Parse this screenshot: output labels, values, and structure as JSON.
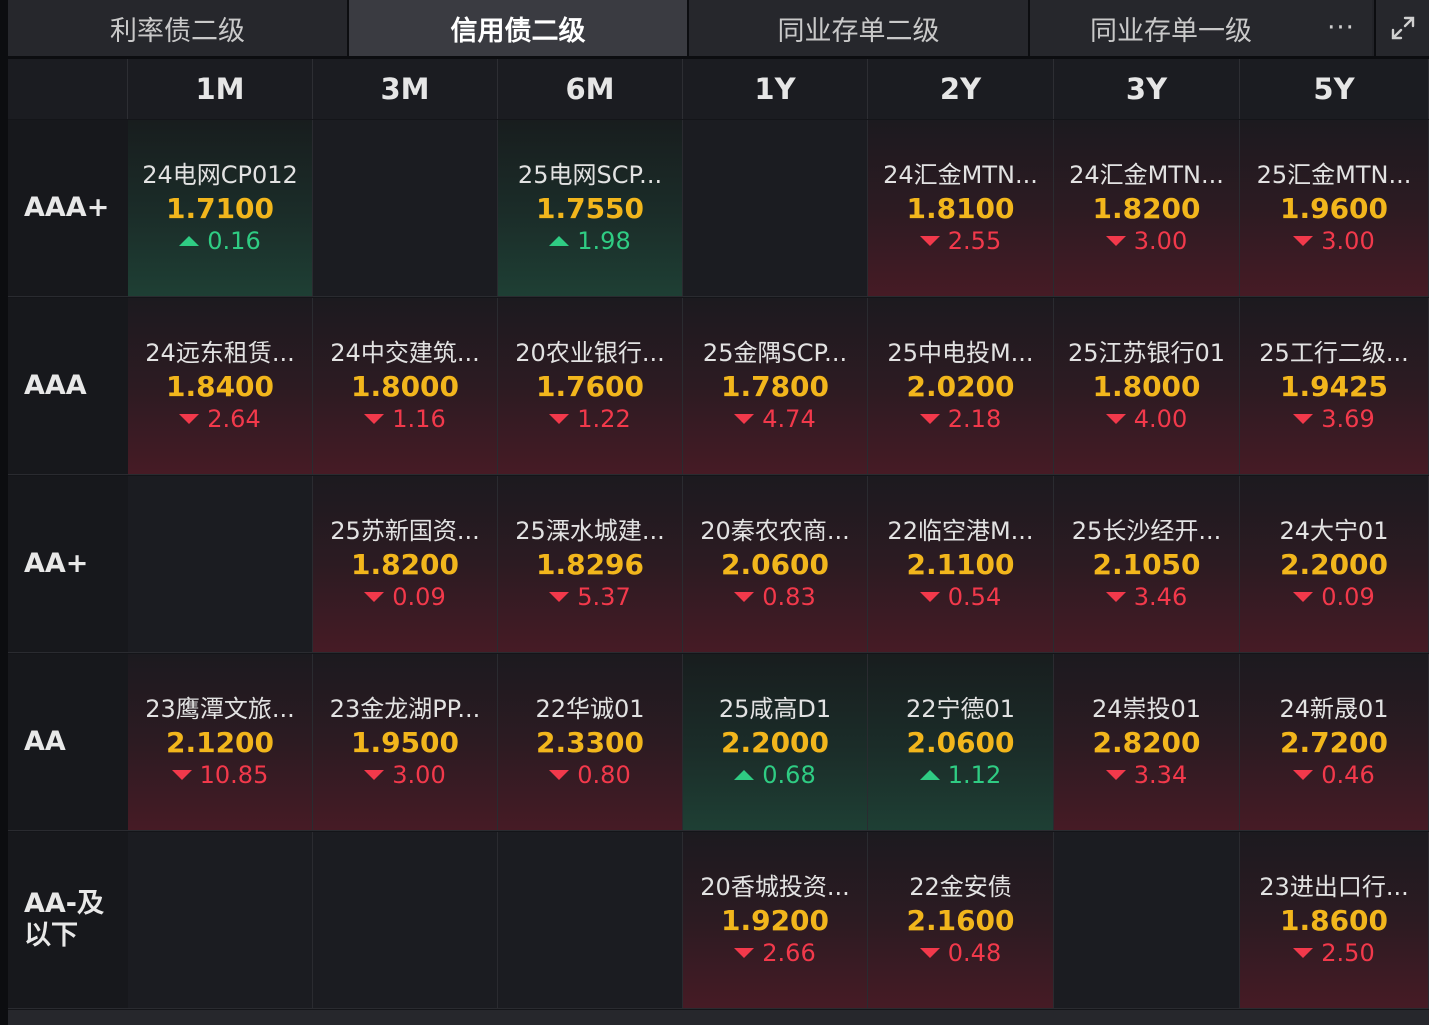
{
  "tabs": [
    {
      "label": "利率债二级",
      "active": false
    },
    {
      "label": "信用债二级",
      "active": true
    },
    {
      "label": "同业存单二级",
      "active": false
    },
    {
      "label": "同业存单一级",
      "active": false
    }
  ],
  "tab_more_label": "···",
  "columns": [
    "1M",
    "3M",
    "6M",
    "1Y",
    "2Y",
    "3Y",
    "5Y"
  ],
  "rows": [
    {
      "rating": "AAA+",
      "cells": [
        {
          "name": "24电网CP012",
          "yield": "1.7100",
          "change": "0.16",
          "dir": "up"
        },
        null,
        {
          "name": "25电网SCP...",
          "yield": "1.7550",
          "change": "1.98",
          "dir": "up"
        },
        null,
        {
          "name": "24汇金MTN...",
          "yield": "1.8100",
          "change": "2.55",
          "dir": "down"
        },
        {
          "name": "24汇金MTN...",
          "yield": "1.8200",
          "change": "3.00",
          "dir": "down"
        },
        {
          "name": "25汇金MTN...",
          "yield": "1.9600",
          "change": "3.00",
          "dir": "down"
        }
      ]
    },
    {
      "rating": "AAA",
      "cells": [
        {
          "name": "24远东租赁...",
          "yield": "1.8400",
          "change": "2.64",
          "dir": "down"
        },
        {
          "name": "24中交建筑...",
          "yield": "1.8000",
          "change": "1.16",
          "dir": "down"
        },
        {
          "name": "20农业银行...",
          "yield": "1.7600",
          "change": "1.22",
          "dir": "down"
        },
        {
          "name": "25金隅SCP...",
          "yield": "1.7800",
          "change": "4.74",
          "dir": "down"
        },
        {
          "name": "25中电投M...",
          "yield": "2.0200",
          "change": "2.18",
          "dir": "down"
        },
        {
          "name": "25江苏银行01",
          "yield": "1.8000",
          "change": "4.00",
          "dir": "down"
        },
        {
          "name": "25工行二级...",
          "yield": "1.9425",
          "change": "3.69",
          "dir": "down"
        }
      ]
    },
    {
      "rating": "AA+",
      "cells": [
        null,
        {
          "name": "25苏新国资...",
          "yield": "1.8200",
          "change": "0.09",
          "dir": "down"
        },
        {
          "name": "25溧水城建...",
          "yield": "1.8296",
          "change": "5.37",
          "dir": "down"
        },
        {
          "name": "20秦农农商...",
          "yield": "2.0600",
          "change": "0.83",
          "dir": "down"
        },
        {
          "name": "22临空港M...",
          "yield": "2.1100",
          "change": "0.54",
          "dir": "down"
        },
        {
          "name": "25长沙经开...",
          "yield": "2.1050",
          "change": "3.46",
          "dir": "down"
        },
        {
          "name": "24大宁01",
          "yield": "2.2000",
          "change": "0.09",
          "dir": "down"
        }
      ]
    },
    {
      "rating": "AA",
      "cells": [
        {
          "name": "23鹰潭文旅...",
          "yield": "2.1200",
          "change": "10.85",
          "dir": "down"
        },
        {
          "name": "23金龙湖PP...",
          "yield": "1.9500",
          "change": "3.00",
          "dir": "down"
        },
        {
          "name": "22华诚01",
          "yield": "2.3300",
          "change": "0.80",
          "dir": "down"
        },
        {
          "name": "25咸高D1",
          "yield": "2.2000",
          "change": "0.68",
          "dir": "up"
        },
        {
          "name": "22宁德01",
          "yield": "2.0600",
          "change": "1.12",
          "dir": "up"
        },
        {
          "name": "24崇投01",
          "yield": "2.8200",
          "change": "3.34",
          "dir": "down"
        },
        {
          "name": "24新晟01",
          "yield": "2.7200",
          "change": "0.46",
          "dir": "down"
        }
      ]
    },
    {
      "rating": "AA-及\n以下",
      "cells": [
        null,
        null,
        null,
        {
          "name": "20香城投资...",
          "yield": "1.9200",
          "change": "2.66",
          "dir": "down"
        },
        {
          "name": "22金安债",
          "yield": "2.1600",
          "change": "0.48",
          "dir": "down"
        },
        null,
        {
          "name": "23进出口行...",
          "yield": "1.8600",
          "change": "2.50",
          "dir": "down"
        }
      ]
    }
  ],
  "colors": {
    "yield": "#f2b61c",
    "up": "#2fcc83",
    "down": "#f2394b"
  }
}
